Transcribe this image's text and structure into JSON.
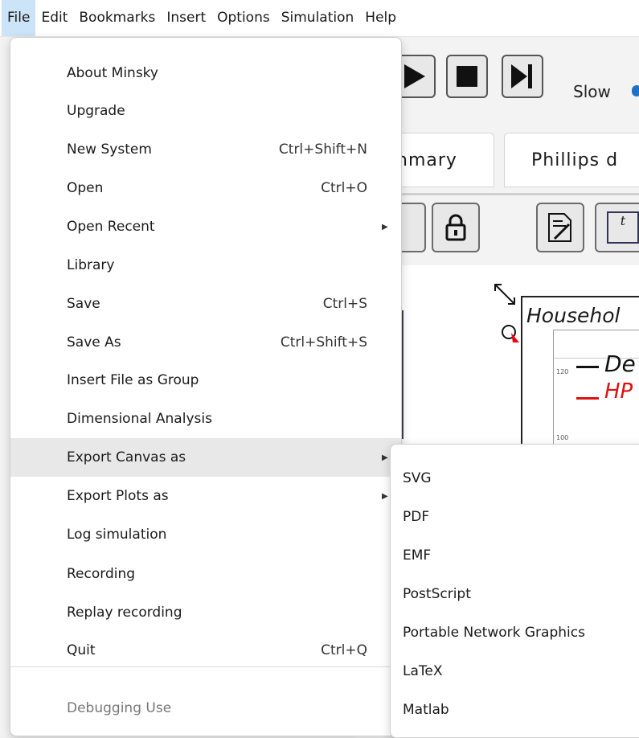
{
  "menubar": {
    "items": [
      "File",
      "Edit",
      "Bookmarks",
      "Insert",
      "Options",
      "Simulation",
      "Help"
    ]
  },
  "background": {
    "speed_label": "Slow",
    "tabs": [
      "nmary",
      "Phillips d"
    ],
    "godley_title": "Househol",
    "legend": [
      "De",
      "HP"
    ],
    "ticks": [
      "120",
      "100"
    ]
  },
  "file_menu": {
    "items": [
      {
        "label": "About Minsky",
        "shortcut": ""
      },
      {
        "label": "Upgrade",
        "shortcut": ""
      },
      {
        "label": "New System",
        "shortcut": "Ctrl+Shift+N"
      },
      {
        "label": "Open",
        "shortcut": "Ctrl+O"
      },
      {
        "label": "Open Recent",
        "shortcut": "",
        "submenu": true
      },
      {
        "label": "Library",
        "shortcut": ""
      },
      {
        "label": "Save",
        "shortcut": "Ctrl+S"
      },
      {
        "label": "Save As",
        "shortcut": "Ctrl+Shift+S"
      },
      {
        "label": "Insert File as Group",
        "shortcut": ""
      },
      {
        "label": "Dimensional Analysis",
        "shortcut": ""
      },
      {
        "label": "Export Canvas as",
        "shortcut": "",
        "submenu": true,
        "highlighted": true
      },
      {
        "label": "Export Plots as",
        "shortcut": "",
        "submenu": true
      },
      {
        "label": "Log simulation",
        "shortcut": ""
      },
      {
        "label": "Recording",
        "shortcut": ""
      },
      {
        "label": "Replay recording",
        "shortcut": ""
      },
      {
        "label": "Quit",
        "shortcut": "Ctrl+Q"
      },
      {
        "label": "Debugging Use",
        "shortcut": "",
        "disabled": true
      }
    ]
  },
  "export_canvas_submenu": {
    "items": [
      "SVG",
      "PDF",
      "EMF",
      "PostScript",
      "Portable Network Graphics",
      "LaTeX",
      "Matlab"
    ]
  },
  "colors": {
    "highlight": "#e8e8e8",
    "active_menubar": "#cce4f7",
    "accent": "#1e73c8"
  }
}
